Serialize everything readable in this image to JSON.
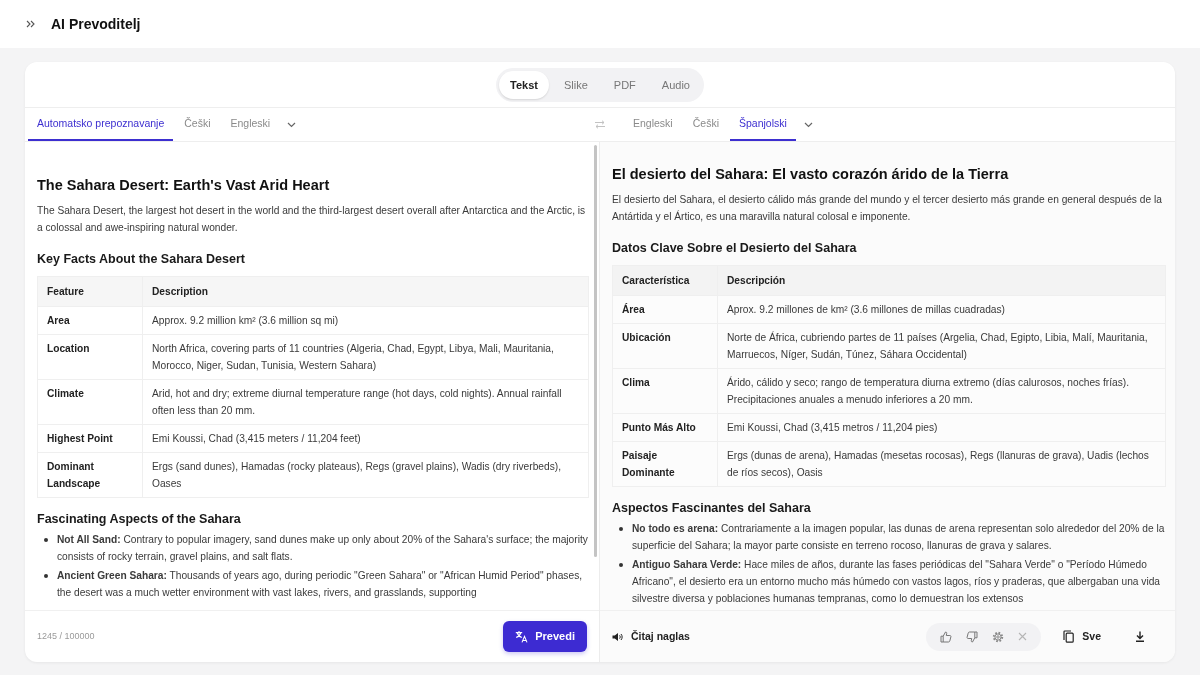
{
  "app": {
    "title": "AI Prevoditelj"
  },
  "modes": [
    {
      "label": "Tekst",
      "selected": true
    },
    {
      "label": "Slike",
      "selected": false
    },
    {
      "label": "PDF",
      "selected": false
    },
    {
      "label": "Audio",
      "selected": false
    }
  ],
  "source": {
    "languages": [
      {
        "label": "Automatsko prepoznavanje",
        "selected": true
      },
      {
        "label": "Češki",
        "selected": false
      },
      {
        "label": "Engleski",
        "selected": false
      }
    ],
    "document": {
      "title": "The Sahara Desert: Earth's Vast Arid Heart",
      "intro": "The Sahara Desert, the largest hot desert in the world and the third-largest desert overall after Antarctica and the Arctic, is a colossal and awe-inspiring natural wonder.",
      "table_heading": "Key Facts About the Sahara Desert",
      "table": {
        "columns": [
          "Feature",
          "Description"
        ],
        "rows": [
          [
            "Area",
            "Approx. 9.2 million km² (3.6 million sq mi)"
          ],
          [
            "Location",
            "North Africa, covering parts of 11 countries (Algeria, Chad, Egypt, Libya, Mali, Mauritania, Morocco, Niger, Sudan, Tunisia, Western Sahara)"
          ],
          [
            "Climate",
            "Arid, hot and dry; extreme diurnal temperature range (hot days, cold nights). Annual rainfall often less than 20 mm."
          ],
          [
            "Highest Point",
            "Emi Koussi, Chad (3,415 meters / 11,204 feet)"
          ],
          [
            "Dominant Landscape",
            "Ergs (sand dunes), Hamadas (rocky plateaus), Regs (gravel plains), Wadis (dry riverbeds), Oases"
          ]
        ]
      },
      "list_heading": "Fascinating Aspects of the Sahara",
      "list_items": [
        "**Not All Sand:** Contrary to popular imagery, sand dunes make up only about 20% of the Sahara's surface; the majority consists of rocky terrain, gravel plains, and salt flats.",
        "**Ancient Green Sahara:** Thousands of years ago, during periodic \"Green Sahara\" or \"African Humid Period\" phases, the desert was a much wetter environment with vast lakes, rivers, and grasslands, supporting"
      ]
    },
    "char_count": "1245 / 100000",
    "translate_button": "Prevedi"
  },
  "target": {
    "languages": [
      {
        "label": "Engleski",
        "selected": false
      },
      {
        "label": "Češki",
        "selected": false
      },
      {
        "label": "Španjolski",
        "selected": true
      }
    ],
    "document": {
      "title": "El desierto del Sahara: El vasto corazón árido de la Tierra",
      "intro": "El desierto del Sahara, el desierto cálido más grande del mundo y el tercer desierto más grande en general después de la Antártida y el Ártico, es una maravilla natural colosal e imponente.",
      "table_heading": "Datos Clave Sobre el Desierto del Sahara",
      "table": {
        "columns": [
          "Característica",
          "Descripción"
        ],
        "rows": [
          [
            "Área",
            "Aprox. 9.2 millones de km² (3.6 millones de millas cuadradas)"
          ],
          [
            "Ubicación",
            "Norte de África, cubriendo partes de 11 países (Argelia, Chad, Egipto, Libia, Malí, Mauritania, Marruecos, Níger, Sudán, Túnez, Sáhara Occidental)"
          ],
          [
            "Clima",
            "Árido, cálido y seco; rango de temperatura diurna extremo (días calurosos, noches frías). Precipitaciones anuales a menudo inferiores a 20 mm."
          ],
          [
            "Punto Más Alto",
            "Emi Koussi, Chad (3,415 metros / 11,204 pies)"
          ],
          [
            "Paisaje Dominante",
            "Ergs (dunas de arena), Hamadas (mesetas rocosas), Regs (llanuras de grava), Uadis (lechos de ríos secos), Oasis"
          ]
        ]
      },
      "list_heading": "Aspectos Fascinantes del Sahara",
      "list_items": [
        "**No todo es arena:** Contrariamente a la imagen popular, las dunas de arena representan solo alrededor del 20% de la superficie del Sahara; la mayor parte consiste en terreno rocoso, llanuras de grava y salares.",
        "**Antiguo Sahara Verde:** Hace miles de años, durante las fases periódicas del \"Sahara Verde\" o \"Período Húmedo Africano\", el desierto era un entorno mucho más húmedo con vastos lagos, ríos y praderas, que albergaban una vida silvestre diversa y poblaciones humanas tempranas, como lo demuestran los extensos"
      ]
    },
    "read_aloud_button": "Čitaj naglas",
    "copy_button": "Sve"
  }
}
